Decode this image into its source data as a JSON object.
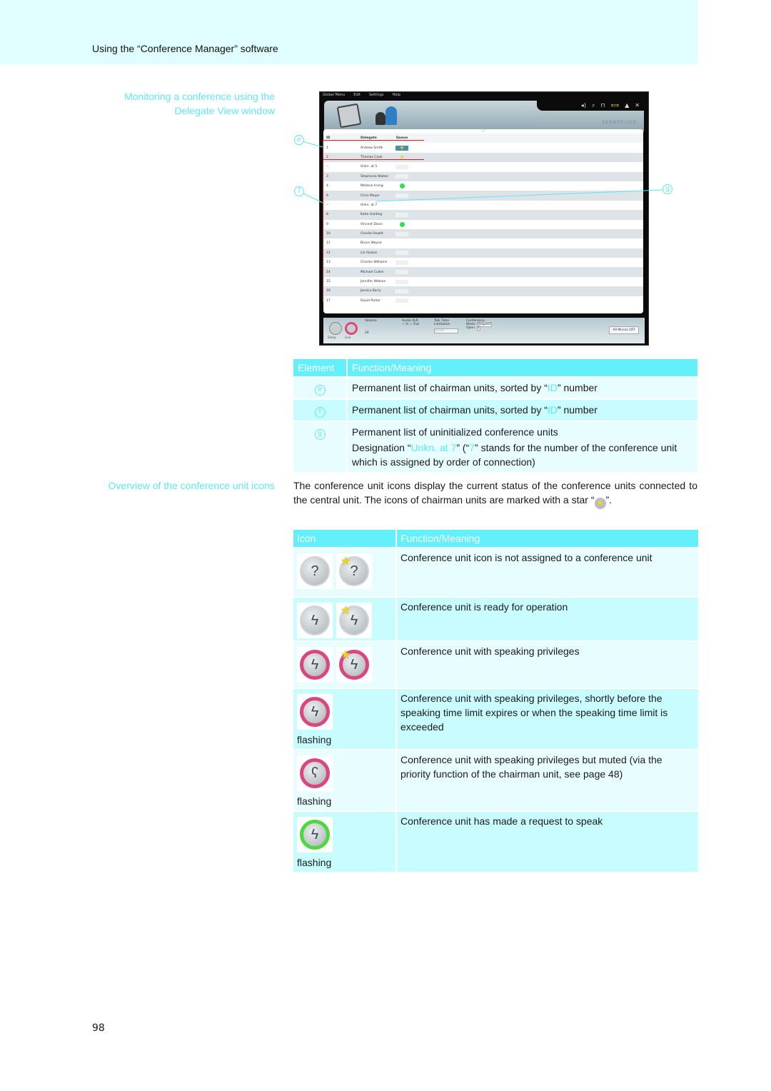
{
  "header": {
    "title": "Using the “Conference Manager” software"
  },
  "sections": {
    "monitoring": {
      "line1": "Monitoring a conference using the",
      "line2": "Delegate View window"
    },
    "overview": "Overview of the conference unit icons"
  },
  "app": {
    "menu": [
      "Global Menu",
      "Edit",
      "Settings",
      "Help"
    ],
    "brand": "SENNHEISER",
    "list_top_marker": "≈T",
    "columns": [
      "ID",
      "Delegate",
      "Queue"
    ],
    "rows": [
      {
        "id": "1",
        "delegate": "Andrew Smith",
        "queue": "star-highlight"
      },
      {
        "id": "2",
        "delegate": "Thomas Cook",
        "queue": "star"
      },
      {
        "id": "--",
        "delegate": "Unkn. at 5",
        "queue": "empty"
      },
      {
        "id": "3",
        "delegate": "Stephanie Walker",
        "queue": "empty"
      },
      {
        "id": "4",
        "delegate": "Melanie Irving",
        "queue": "green"
      },
      {
        "id": "6",
        "delegate": "Chris Meyer",
        "queue": "empty"
      },
      {
        "id": "--",
        "delegate": "Unkn. at 7",
        "queue": "none"
      },
      {
        "id": "8",
        "delegate": "Katie Golding",
        "queue": "empty"
      },
      {
        "id": "9",
        "delegate": "Vincent Davis",
        "queue": "green"
      },
      {
        "id": "10",
        "delegate": "Charlie Hewitt",
        "queue": "empty"
      },
      {
        "id": "11",
        "delegate": "Bruce Wayne",
        "queue": "none"
      },
      {
        "id": "12",
        "delegate": "Liz Huston",
        "queue": "empty"
      },
      {
        "id": "13",
        "delegate": "Charles Williams",
        "queue": "empty"
      },
      {
        "id": "14",
        "delegate": "Michael Cullen",
        "queue": "empty"
      },
      {
        "id": "15",
        "delegate": "Jennifer Watson",
        "queue": "empty"
      },
      {
        "id": "16",
        "delegate": "Jessica Barry",
        "queue": "empty"
      },
      {
        "id": "17",
        "delegate": "David Porter",
        "queue": "empty"
      }
    ],
    "bottom": {
      "setup": "Setup",
      "live": "Live",
      "volume": "Volume",
      "volume_value": "24",
      "audio_xlr": "Audio XLR",
      "in": "In",
      "out": "Out",
      "talk_time": "Talk Time",
      "limitation": "Limitation",
      "talk_time_value": "02:00",
      "conference": "Conference",
      "mode_label": "Mode:",
      "mode_value": "Request",
      "open_label": "Open:",
      "open_value": "4",
      "all_micros_off": "All Micros OFF"
    }
  },
  "callouts": {
    "e": "e",
    "f": "f",
    "g": "g"
  },
  "element_table": {
    "headers": [
      "Element",
      "Function/Meaning"
    ],
    "rows": [
      {
        "element": "e",
        "pre": "Permanent list of chairman units, sorted by “",
        "hl": "ID",
        "post": "” number"
      },
      {
        "element": "f",
        "pre": "Permanent list of chairman units, sorted by “",
        "hl": "ID",
        "post": "” number"
      },
      {
        "element": "g",
        "line1": "Permanent list of uninitialized conference units",
        "pre": "Designation “",
        "hl": "Unkn. at 7",
        "mid": "” (“",
        "hl2": "7",
        "post": "” stands for the number of the conference unit which is assigned by order of connection)"
      }
    ]
  },
  "intro": {
    "text": "The conference unit icons display the current status of the conference units connected to the central unit. The icons of chairman units are marked with a star “",
    "after": "”."
  },
  "icon_table": {
    "headers": [
      "Icon",
      "Function/Meaning"
    ],
    "rows": [
      {
        "icons": [
          "unassigned",
          "unassigned-chairman"
        ],
        "note": "",
        "meaning": "Conference unit icon is not assigned to a conference unit"
      },
      {
        "icons": [
          "ready",
          "ready-chairman"
        ],
        "note": "",
        "meaning": "Conference unit is ready for operation"
      },
      {
        "icons": [
          "speaking",
          "speaking-chairman"
        ],
        "note": "",
        "meaning": "Conference unit with speaking privileges"
      },
      {
        "icons": [
          "speaking-time-limit"
        ],
        "note": "flashing",
        "meaning": "Conference unit with speaking privileges, shortly before the speaking time limit expires or when the speaking time limit is exceeded"
      },
      {
        "icons": [
          "speaking-muted"
        ],
        "note": "flashing",
        "meaning": "Conference unit with speaking privileges but muted (via the priority function of the chairman unit, see page 48)"
      },
      {
        "icons": [
          "request-to-speak"
        ],
        "note": "flashing",
        "meaning": "Conference unit has made a request to speak"
      }
    ]
  },
  "page_number": "98",
  "colors": {
    "accent": "#5de8f5",
    "table_header": "#63f0fb",
    "row_light": "#e8fdff",
    "row_dark": "#c8fcff",
    "header_band": "#e0feff",
    "marker_red": "#e1191d",
    "speaking_ring": "#d9477f",
    "request_ring": "#4ed83d"
  }
}
